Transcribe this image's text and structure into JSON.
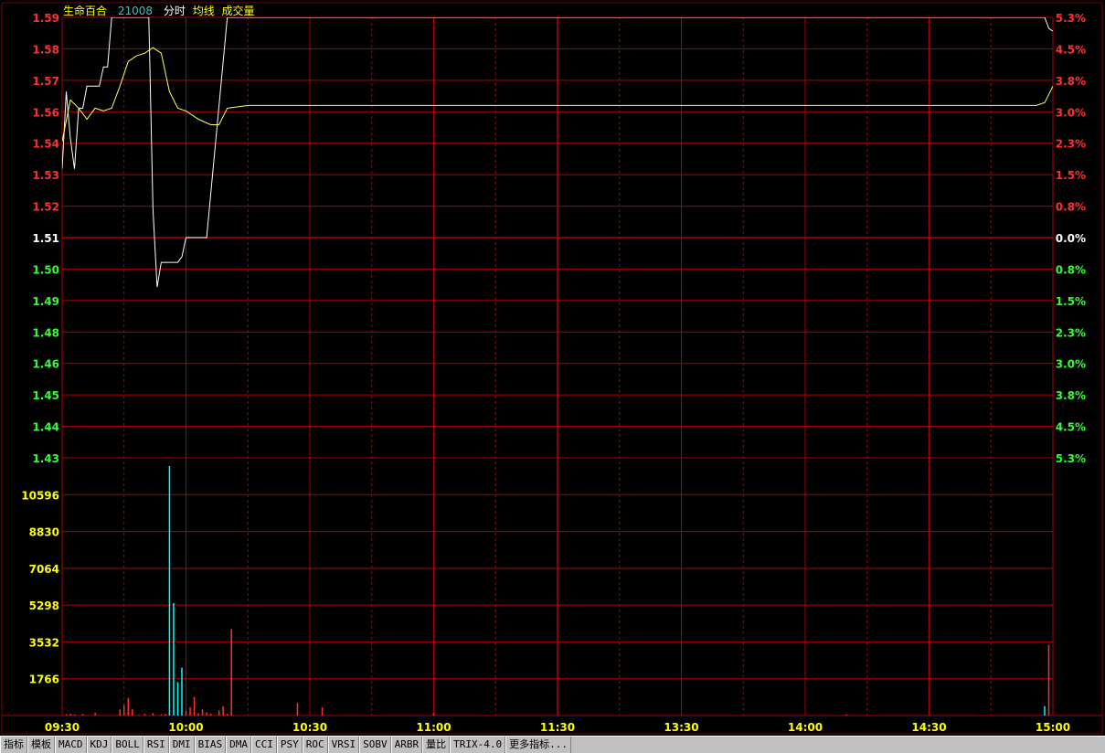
{
  "stock": {
    "name": "生命百合",
    "code": "21008",
    "labels": [
      "分时",
      "均线",
      "成交量"
    ]
  },
  "tabs": [
    "指标",
    "模板",
    "MACD",
    "KDJ",
    "BOLL",
    "RSI",
    "DMI",
    "BIAS",
    "DMA",
    "CCI",
    "PSY",
    "ROC",
    "VRSI",
    "SOBV",
    "ARBR",
    "量比",
    "TRIX-4.0",
    "更多指标..."
  ],
  "colors": {
    "grid": "#b00000",
    "price_line": "#ffffff",
    "avg_line": "#ffff60",
    "up": "#ff3030",
    "down": "#30ff30",
    "neutral": "#ffffff",
    "volume_axis": "#ffff00",
    "time_axis": "#ffff00",
    "vol_up": "#ff3030",
    "vol_down": "#00ffff"
  },
  "chart_data": [
    {
      "type": "line",
      "title": "",
      "prev_close": 1.51,
      "y_ticks": [
        "1.59",
        "1.58",
        "1.57",
        "1.56",
        "1.54",
        "1.53",
        "1.52",
        "1.51",
        "1.50",
        "1.49",
        "1.48",
        "1.46",
        "1.45",
        "1.44",
        "1.43"
      ],
      "y_pct_ticks": [
        "5.3%",
        "4.5%",
        "3.8%",
        "3.0%",
        "2.3%",
        "1.5%",
        "0.8%",
        "0.0%",
        "0.8%",
        "1.5%",
        "2.3%",
        "3.0%",
        "3.8%",
        "4.5%",
        "5.3%"
      ],
      "ylim": [
        1.43,
        1.59
      ],
      "x_ticks": [
        "09:30",
        "10:00",
        "10:30",
        "11:00",
        "11:30",
        "13:30",
        "14:00",
        "14:30",
        "15:00"
      ],
      "series": [
        {
          "name": "分时",
          "x": [
            0,
            1,
            2,
            3,
            4,
            5,
            6,
            7,
            8,
            9,
            10,
            11,
            12,
            13,
            14,
            15,
            16,
            17,
            18,
            19,
            20,
            21,
            22,
            23,
            24,
            25,
            26,
            27,
            28,
            29,
            30,
            35,
            40,
            45,
            50,
            55,
            60,
            90,
            120,
            180,
            220,
            235,
            238,
            239,
            240
          ],
          "values": [
            1.535,
            1.563,
            1.546,
            1.535,
            1.557,
            1.557,
            1.565,
            1.565,
            1.565,
            1.565,
            1.572,
            1.572,
            1.59,
            1.59,
            1.59,
            1.59,
            1.59,
            1.59,
            1.59,
            1.59,
            1.59,
            1.59,
            1.52,
            1.492,
            1.501,
            1.501,
            1.501,
            1.501,
            1.501,
            1.503,
            1.51,
            1.51,
            1.59,
            1.59,
            1.59,
            1.59,
            1.59,
            1.59,
            1.59,
            1.59,
            1.59,
            1.59,
            1.59,
            1.586,
            1.585
          ]
        },
        {
          "name": "均线",
          "x": [
            0,
            2,
            4,
            6,
            8,
            10,
            12,
            14,
            16,
            18,
            20,
            22,
            24,
            26,
            28,
            30,
            33,
            36,
            38,
            40,
            45,
            60,
            90,
            120,
            180,
            230,
            236,
            238,
            240
          ],
          "values": [
            1.545,
            1.56,
            1.557,
            1.553,
            1.557,
            1.556,
            1.557,
            1.565,
            1.574,
            1.576,
            1.577,
            1.579,
            1.577,
            1.563,
            1.557,
            1.556,
            1.553,
            1.551,
            1.551,
            1.557,
            1.558,
            1.558,
            1.558,
            1.558,
            1.558,
            1.558,
            1.558,
            1.559,
            1.565
          ]
        }
      ]
    },
    {
      "type": "bar",
      "title": "成交量",
      "y_ticks": [
        "10596",
        "8830",
        "7064",
        "5298",
        "3532",
        "1766"
      ],
      "ylim": [
        0,
        12362
      ],
      "x": [
        1,
        2,
        3,
        5,
        8,
        14,
        15,
        16,
        17,
        20,
        22,
        24,
        25,
        26,
        27,
        28,
        29,
        30,
        31,
        32,
        33,
        34,
        35,
        36,
        38,
        39,
        40,
        41,
        57,
        63,
        90,
        190,
        238,
        239
      ],
      "values": [
        60,
        90,
        60,
        70,
        130,
        300,
        500,
        850,
        300,
        80,
        120,
        60,
        80,
        11970,
        5400,
        1600,
        2300,
        230,
        400,
        900,
        110,
        300,
        160,
        90,
        250,
        450,
        80,
        4150,
        600,
        400,
        120,
        60,
        450,
        3400
      ],
      "directions": [
        "up",
        "up",
        "up",
        "up",
        "up",
        "up",
        "up",
        "up",
        "up",
        "up",
        "up",
        "up",
        "up",
        "down",
        "down",
        "down",
        "down",
        "up",
        "up",
        "up",
        "up",
        "up",
        "up",
        "up",
        "up",
        "up",
        "up",
        "up",
        "up",
        "up",
        "up",
        "up",
        "down",
        "up"
      ]
    }
  ]
}
